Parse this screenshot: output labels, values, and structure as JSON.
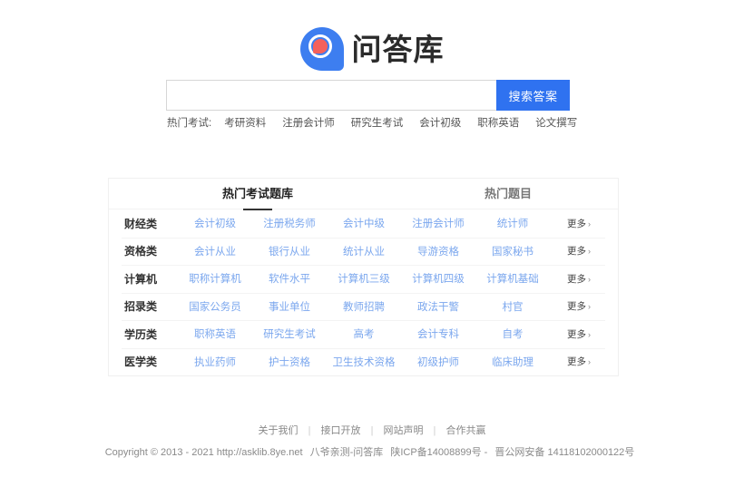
{
  "site": {
    "logo_text": "问答库",
    "logo_icon": "speech-bubble-q-logo",
    "brand_blue": "#3d7ef0",
    "brand_red": "#f4615c",
    "button_blue": "#2f72f0",
    "link_blue": "#7ba7ee"
  },
  "search": {
    "value": "",
    "placeholder": "",
    "button_label": "搜索答案"
  },
  "hot_exams": {
    "label": "热门考试:",
    "items": [
      {
        "label": "考研资料"
      },
      {
        "label": "注册会计师"
      },
      {
        "label": "研究生考试"
      },
      {
        "label": "会计初级"
      },
      {
        "label": "职称英语"
      },
      {
        "label": "论文撰写"
      }
    ]
  },
  "card": {
    "tabs": [
      {
        "label": "热门考试题库",
        "active": true
      },
      {
        "label": "热门题目",
        "active": false
      }
    ],
    "more_label": "更多",
    "more_chevron": "›",
    "rows": [
      {
        "category": "财经类",
        "links": [
          "会计初级",
          "注册税务师",
          "会计中级",
          "注册会计师",
          "统计师"
        ]
      },
      {
        "category": "资格类",
        "links": [
          "会计从业",
          "银行从业",
          "统计从业",
          "导游资格",
          "国家秘书"
        ]
      },
      {
        "category": "计算机",
        "links": [
          "职称计算机",
          "软件水平",
          "计算机三级",
          "计算机四级",
          "计算机基础"
        ]
      },
      {
        "category": "招录类",
        "links": [
          "国家公务员",
          "事业单位",
          "教师招聘",
          "政法干警",
          "村官"
        ]
      },
      {
        "category": "学历类",
        "links": [
          "职称英语",
          "研究生考试",
          "高考",
          "会计专科",
          "自考"
        ]
      },
      {
        "category": "医学类",
        "links": [
          "执业药师",
          "护士资格",
          "卫生技术资格",
          "初级护师",
          "临床助理"
        ]
      }
    ]
  },
  "footer": {
    "links": [
      {
        "label": "关于我们"
      },
      {
        "label": "接口开放"
      },
      {
        "label": "网站声明"
      },
      {
        "label": "合作共赢"
      }
    ],
    "separator": "|",
    "copyright": "Copyright © 2013 - 2021 http://asklib.8ye.net",
    "site_name": "八爷亲测-问答库",
    "icp": "陕ICP备14008899号 -",
    "police": "晋公网安备 14118102000122号"
  }
}
